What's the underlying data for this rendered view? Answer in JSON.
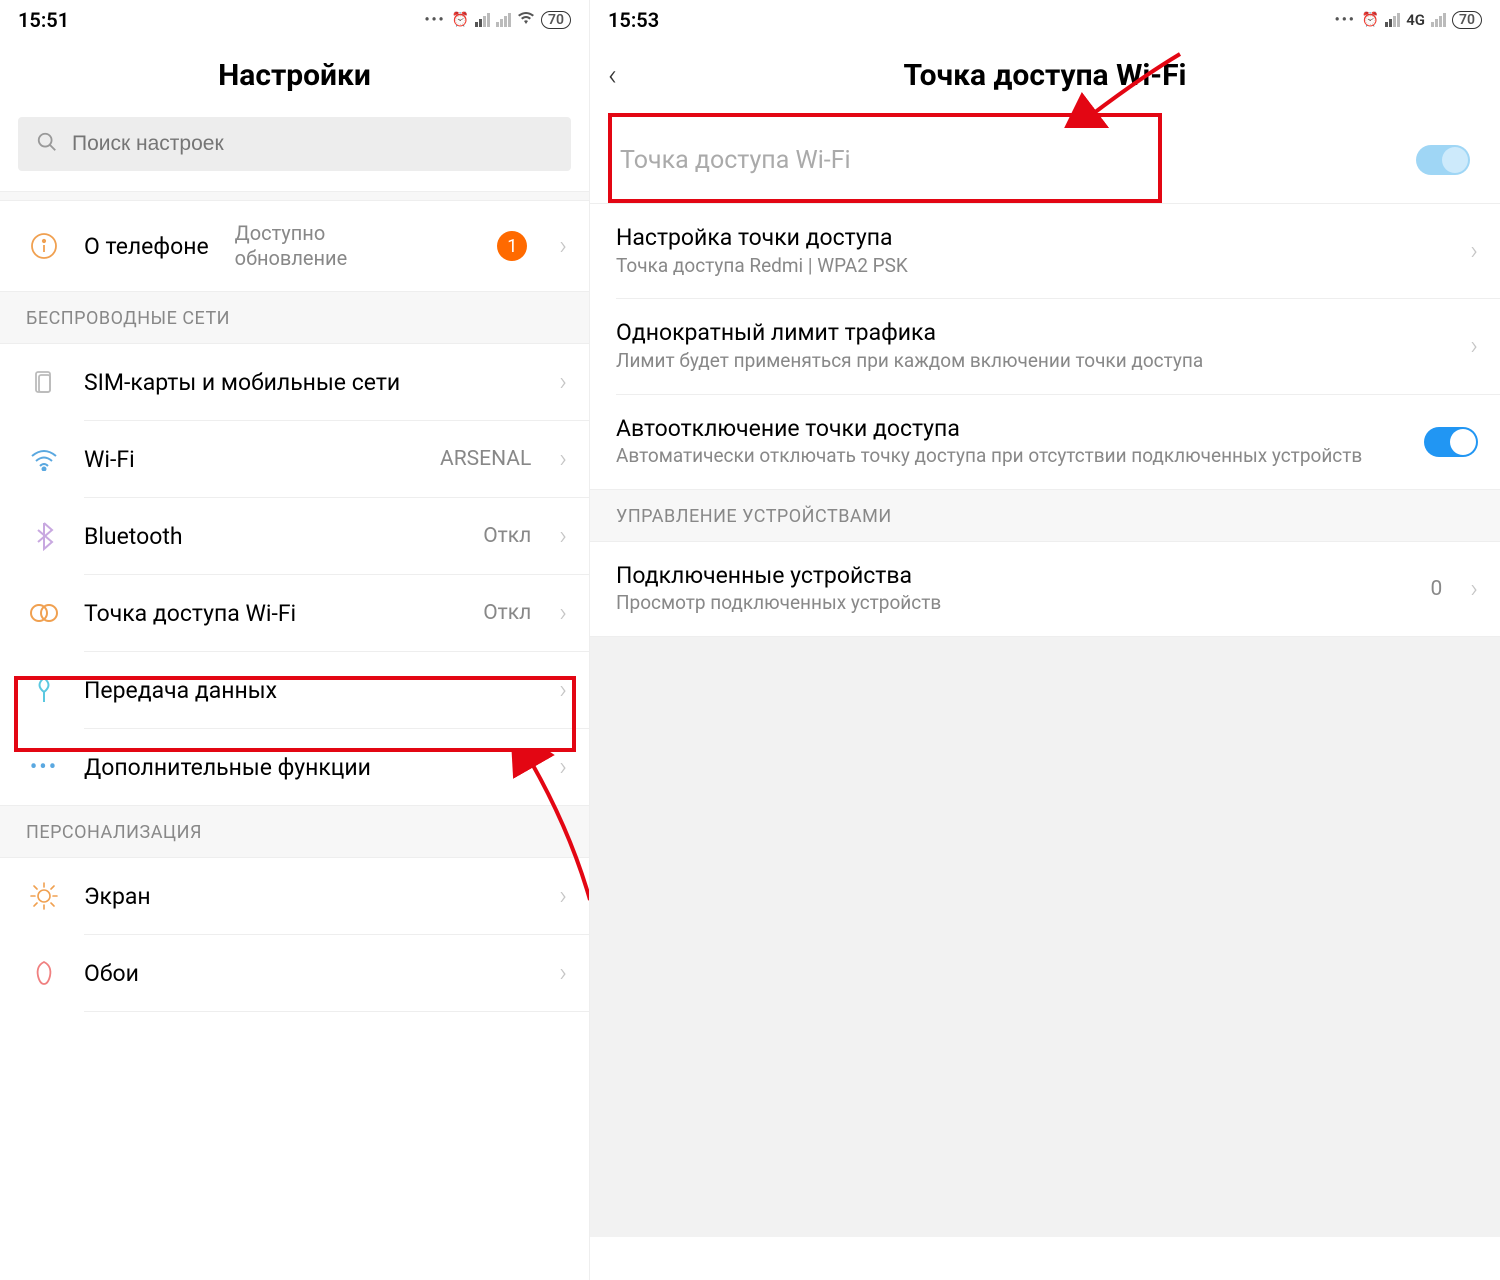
{
  "left": {
    "time": "15:51",
    "battery": "70",
    "title": "Настройки",
    "search_placeholder": "Поиск настроек",
    "about": {
      "label": "О телефоне",
      "secondary": "Доступно\nобновление",
      "badge": "1"
    },
    "section_wireless": "БЕСПРОВОДНЫЕ СЕТИ",
    "items_wireless": [
      {
        "label": "SIM-карты и мобильные сети",
        "value": ""
      },
      {
        "label": "Wi-Fi",
        "value": "ARSENAL"
      },
      {
        "label": "Bluetooth",
        "value": "Откл"
      },
      {
        "label": "Точка доступа Wi-Fi",
        "value": "Откл"
      },
      {
        "label": "Передача данных",
        "value": ""
      },
      {
        "label": "Дополнительные функции",
        "value": ""
      }
    ],
    "section_personal": "ПЕРСОНАЛИЗАЦИЯ",
    "items_personal": [
      {
        "label": "Экран"
      },
      {
        "label": "Обои"
      }
    ]
  },
  "right": {
    "time": "15:53",
    "battery": "70",
    "net": "4G",
    "title": "Точка доступа Wi-Fi",
    "hotspot_toggle_label": "Точка доступа Wi-Fi",
    "rows": [
      {
        "label": "Настройка точки доступа",
        "sub": "Точка доступа Redmi | WPA2 PSK"
      },
      {
        "label": "Однократный лимит трафика",
        "sub": "Лимит будет применяться при каждом включении точки доступа"
      },
      {
        "label": "Автоотключение точки доступа",
        "sub": "Автоматически отключать точку доступа при отсутствии подключенных устройств"
      }
    ],
    "section_devices": "УПРАВЛЕНИЕ УСТРОЙСТВАМИ",
    "connected": {
      "label": "Подключенные устройства",
      "sub": "Просмотр подключенных устройств",
      "value": "0"
    }
  }
}
